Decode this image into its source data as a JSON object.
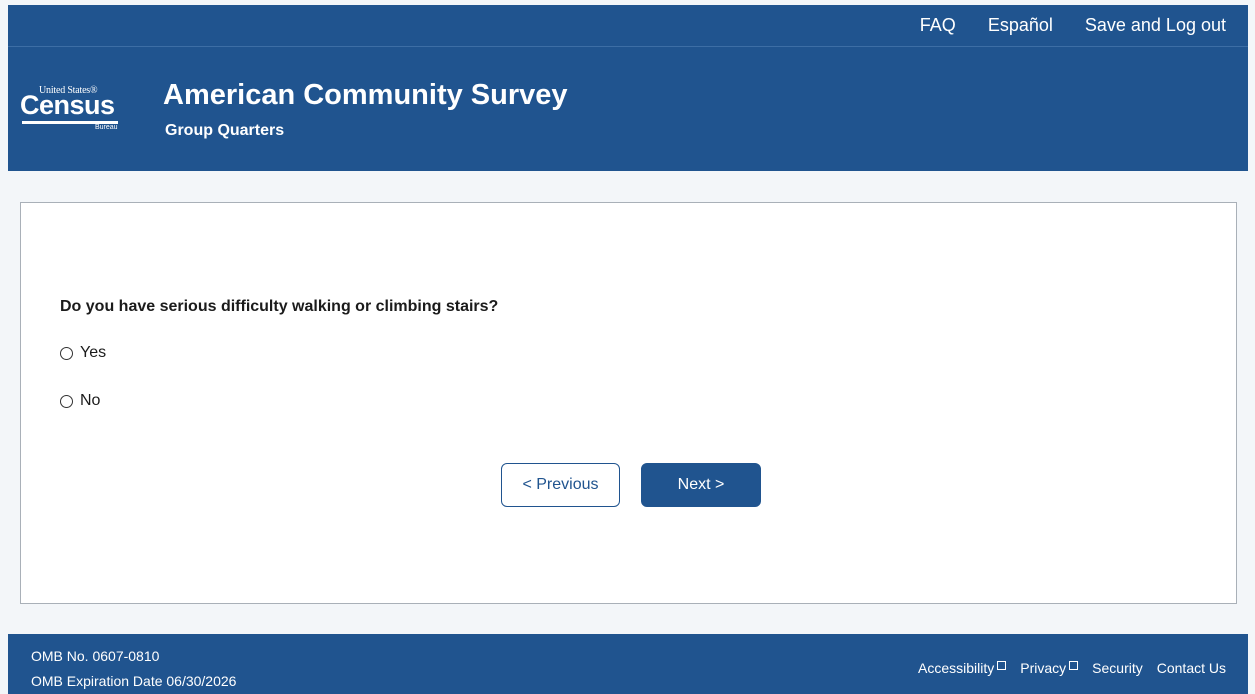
{
  "topnav": {
    "faq": "FAQ",
    "espanol": "Español",
    "save_logout": "Save and Log out"
  },
  "header": {
    "logo": {
      "top_text": "United States®",
      "main_text": "Census",
      "bottom_text": "Bureau"
    },
    "title": "American Community Survey",
    "subtitle": "Group Quarters"
  },
  "question": {
    "text": "Do you have serious difficulty walking or climbing stairs?",
    "options": [
      {
        "label": "Yes",
        "selected": false
      },
      {
        "label": "No",
        "selected": false
      }
    ]
  },
  "buttons": {
    "previous": "< Previous",
    "next": "Next >"
  },
  "footer": {
    "omb_no": "OMB No. 0607-0810",
    "omb_expiration": "OMB Expiration Date 06/30/2026",
    "links": {
      "accessibility": "Accessibility",
      "privacy": "Privacy",
      "security": "Security",
      "contact_us": "Contact Us"
    }
  },
  "colors": {
    "brand_blue": "#20548f",
    "page_bg": "#f3f6f9",
    "card_border": "#a9b0b8"
  },
  "icons": {
    "external_link": "external-link-icon",
    "radio": "radio-unchecked-icon"
  }
}
